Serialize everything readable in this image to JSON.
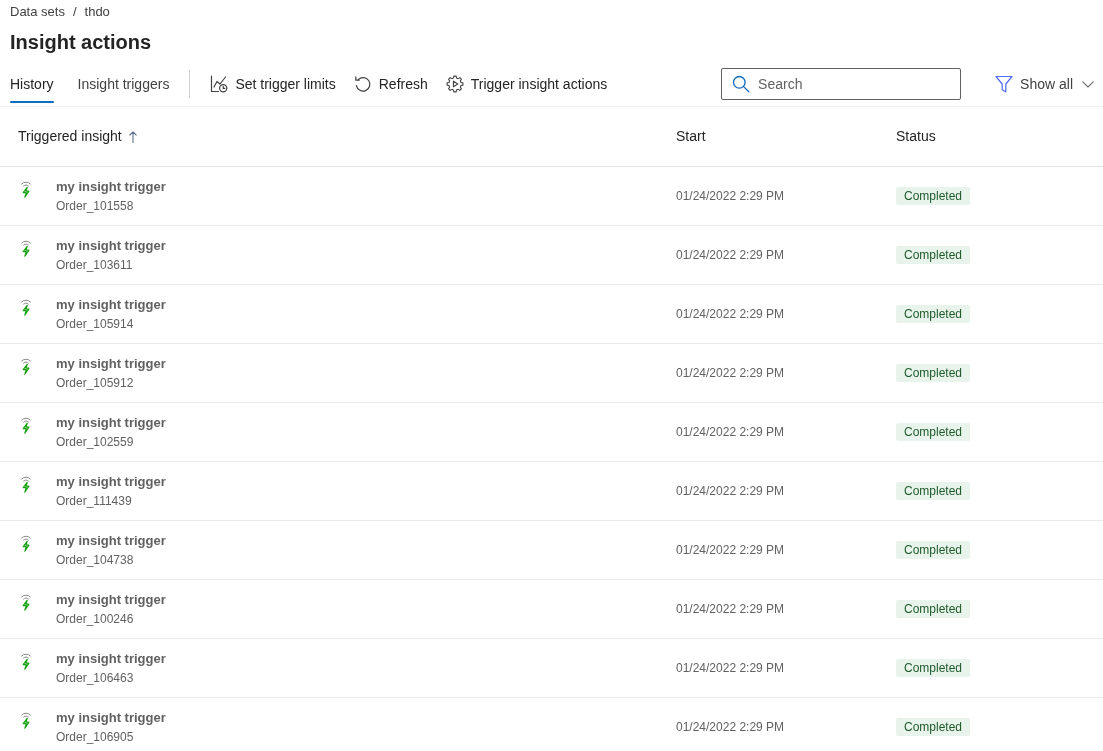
{
  "breadcrumb": {
    "items": [
      {
        "label": "Data sets"
      },
      {
        "label": "thdo"
      }
    ],
    "separator": "/"
  },
  "title": "Insight actions",
  "tabs": [
    {
      "label": "History",
      "selected": true
    },
    {
      "label": "Insight triggers",
      "selected": false
    }
  ],
  "toolbar": [
    {
      "label": "Set trigger limits",
      "kind": "limits"
    },
    {
      "label": "Refresh",
      "kind": "refresh"
    },
    {
      "label": "Trigger insight actions",
      "kind": "run"
    }
  ],
  "search": {
    "placeholder": "Search"
  },
  "filter": {
    "label": "Show all"
  },
  "table": {
    "columns": [
      {
        "label": "Triggered insight",
        "sorted": true
      },
      {
        "label": "Start",
        "sorted": false
      },
      {
        "label": "Status",
        "sorted": false
      }
    ],
    "rows": [
      {
        "name": "my insight trigger",
        "order": "Order_101558",
        "start": "01/24/2022 2:29 PM",
        "status": "Completed"
      },
      {
        "name": "my insight trigger",
        "order": "Order_103611",
        "start": "01/24/2022 2:29 PM",
        "status": "Completed"
      },
      {
        "name": "my insight trigger",
        "order": "Order_105914",
        "start": "01/24/2022 2:29 PM",
        "status": "Completed"
      },
      {
        "name": "my insight trigger",
        "order": "Order_105912",
        "start": "01/24/2022 2:29 PM",
        "status": "Completed"
      },
      {
        "name": "my insight trigger",
        "order": "Order_102559",
        "start": "01/24/2022 2:29 PM",
        "status": "Completed"
      },
      {
        "name": "my insight trigger",
        "order": "Order_111439",
        "start": "01/24/2022 2:29 PM",
        "status": "Completed"
      },
      {
        "name": "my insight trigger",
        "order": "Order_104738",
        "start": "01/24/2022 2:29 PM",
        "status": "Completed"
      },
      {
        "name": "my insight trigger",
        "order": "Order_100246",
        "start": "01/24/2022 2:29 PM",
        "status": "Completed"
      },
      {
        "name": "my insight trigger",
        "order": "Order_106463",
        "start": "01/24/2022 2:29 PM",
        "status": "Completed"
      },
      {
        "name": "my insight trigger",
        "order": "Order_106905",
        "start": "01/24/2022 2:29 PM",
        "status": "Completed"
      }
    ]
  }
}
